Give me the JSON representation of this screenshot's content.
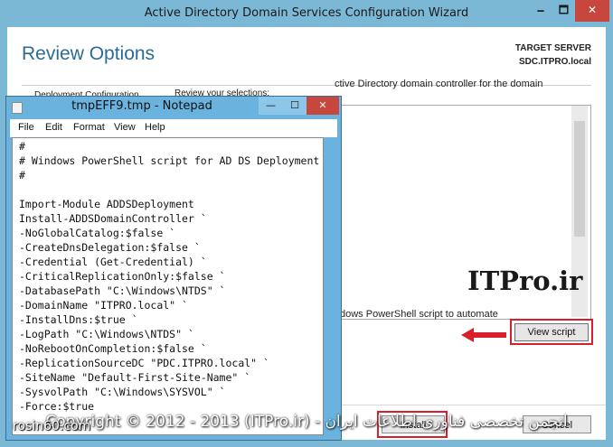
{
  "wizard": {
    "title": "Active Directory Domain Services Configuration Wizard",
    "minimize_glyph": "🗕",
    "maximize_glyph": "🗖",
    "close_glyph": "✕",
    "page_title": "Review Options",
    "target_server_label": "TARGET SERVER",
    "target_server_name": "SDC.ITPRO.local",
    "nav_partial": "Deployment Configuration",
    "review_label": "Review your selections:",
    "review_text": "ctive Directory domain controller for the domain",
    "powershell_text": "dows PowerShell script to automate",
    "view_script_button": "View script",
    "install_button": "Install",
    "cancel_button": "Cancel"
  },
  "watermark_text": "ITPro.ir",
  "overlay": {
    "copyright": "Copyright © 2012 - 2013 (ITPro.ir) - انجمن تخصصی فناوری اطلاعات ایران",
    "site_tag": "rosin60.com"
  },
  "notepad": {
    "title": "tmpEFF9.tmp - Notepad",
    "minimize_glyph": "—",
    "maximize_glyph": "☐",
    "close_glyph": "✕",
    "menu": [
      "File",
      "Edit",
      "Format",
      "View",
      "Help"
    ],
    "lines": [
      "#",
      "# Windows PowerShell script for AD DS Deployment",
      "#",
      "",
      "Import-Module ADDSDeployment",
      "Install-ADDSDomainController `",
      "-NoGlobalCatalog:$false `",
      "-CreateDnsDelegation:$false `",
      "-Credential (Get-Credential) `",
      "-CriticalReplicationOnly:$false `",
      "-DatabasePath \"C:\\Windows\\NTDS\" `",
      "-DomainName \"ITPRO.local\" `",
      "-InstallDns:$true `",
      "-LogPath \"C:\\Windows\\NTDS\" `",
      "-NoRebootOnCompletion:$false `",
      "-ReplicationSourceDC \"PDC.ITPRO.local\" `",
      "-SiteName \"Default-First-Site-Name\" `",
      "-SysvolPath \"C:\\Windows\\SYSVOL\" `",
      "-Force:$true"
    ]
  },
  "colors": {
    "accent_red": "#d81f2b",
    "title_blue": "#2a6c96",
    "window_frame": "#7ab8d6"
  }
}
